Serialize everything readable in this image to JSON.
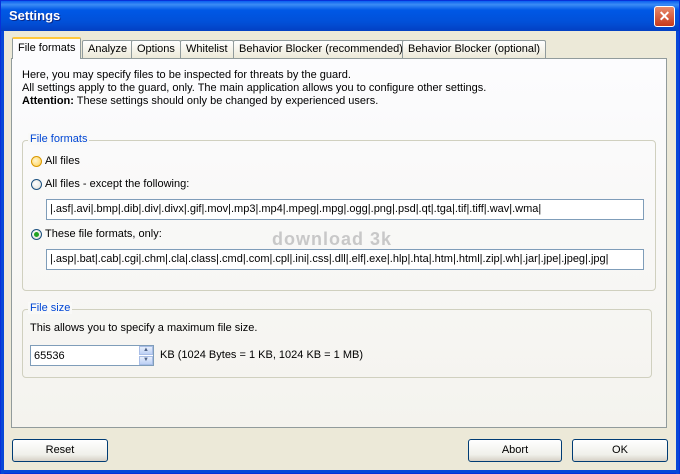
{
  "window": {
    "title": "Settings",
    "close_glyph": "✕"
  },
  "tabs": [
    {
      "label": "File formats",
      "active": true
    },
    {
      "label": "Analyze"
    },
    {
      "label": "Options"
    },
    {
      "label": "Whitelist"
    },
    {
      "label": "Behavior Blocker (recommended)"
    },
    {
      "label": "Behavior Blocker (optional)"
    }
  ],
  "intro": {
    "line1": "Here, you may specify files to be inspected for threats by the guard.",
    "line2": "All settings apply to the guard, only. The main application allows you to configure other settings.",
    "attention_label": "Attention:",
    "attention_text": " These settings should only be changed by experienced users."
  },
  "file_formats": {
    "legend": "File formats",
    "options": [
      {
        "label": "All files",
        "checked": false
      },
      {
        "label": "All files - except the following:",
        "checked": false
      },
      {
        "label": "These file formats, only:",
        "checked": true
      }
    ],
    "except_list": "|.asf|.avi|.bmp|.dib|.div|.divx|.gif|.mov|.mp3|.mp4|.mpeg|.mpg|.ogg|.png|.psd|.qt|.tga|.tif|.tiff|.wav|.wma|",
    "only_list": "|.asp|.bat|.cab|.cgi|.chm|.cla|.class|.cmd|.com|.cpl|.ini|.css|.dll|.elf|.exe|.hlp|.hta|.htm|.html|.zip|.wh|.jar|.jpe|.jpeg|.jpg|"
  },
  "watermark": "download 3k",
  "file_size": {
    "legend": "File size",
    "description": "This allows you to specify a maximum file size.",
    "value": "65536",
    "unit": "KB (1024 Bytes = 1 KB, 1024 KB = 1 MB)"
  },
  "buttons": {
    "reset": "Reset",
    "abort": "Abort",
    "ok": "OK"
  },
  "colors": {
    "titlebar": "#0058e6",
    "accent_tab": "#ffc83c",
    "legend": "#0046d5",
    "selected_radio": "#21a121"
  }
}
